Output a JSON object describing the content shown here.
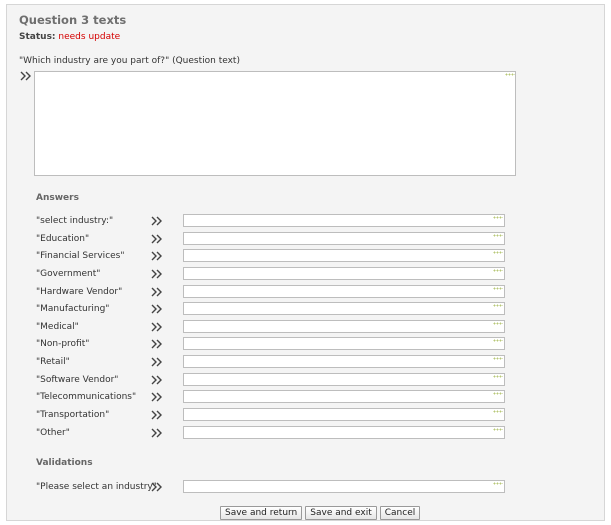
{
  "page": {
    "title": "Question 3 texts",
    "status_label": "Status:",
    "status_value": "needs update",
    "question_text_label": "\"Which industry are you part of?\" (Question text)",
    "question_text_value": ""
  },
  "answers": {
    "heading": "Answers",
    "items": [
      {
        "label": "\"select industry:\"",
        "value": ""
      },
      {
        "label": "\"Education\"",
        "value": ""
      },
      {
        "label": "\"Financial Services\"",
        "value": ""
      },
      {
        "label": "\"Government\"",
        "value": ""
      },
      {
        "label": "\"Hardware Vendor\"",
        "value": ""
      },
      {
        "label": "\"Manufacturing\"",
        "value": ""
      },
      {
        "label": "\"Medical\"",
        "value": ""
      },
      {
        "label": "\"Non-profit\"",
        "value": ""
      },
      {
        "label": "\"Retail\"",
        "value": ""
      },
      {
        "label": "\"Software Vendor\"",
        "value": ""
      },
      {
        "label": "\"Telecommunications\"",
        "value": ""
      },
      {
        "label": "\"Transportation\"",
        "value": ""
      },
      {
        "label": "\"Other\"",
        "value": ""
      }
    ]
  },
  "validations": {
    "heading": "Validations",
    "items": [
      {
        "label": "\"Please select an industry\"",
        "value": ""
      }
    ]
  },
  "buttons": {
    "save_return": "Save and return",
    "save_exit": "Save and exit",
    "cancel": "Cancel"
  },
  "icons": {
    "copy_arrow": "double-chevron-right-icon"
  },
  "colors": {
    "status_value": "#d40000",
    "title": "#6f6f6f",
    "panel_background": "#f4f4f4"
  }
}
